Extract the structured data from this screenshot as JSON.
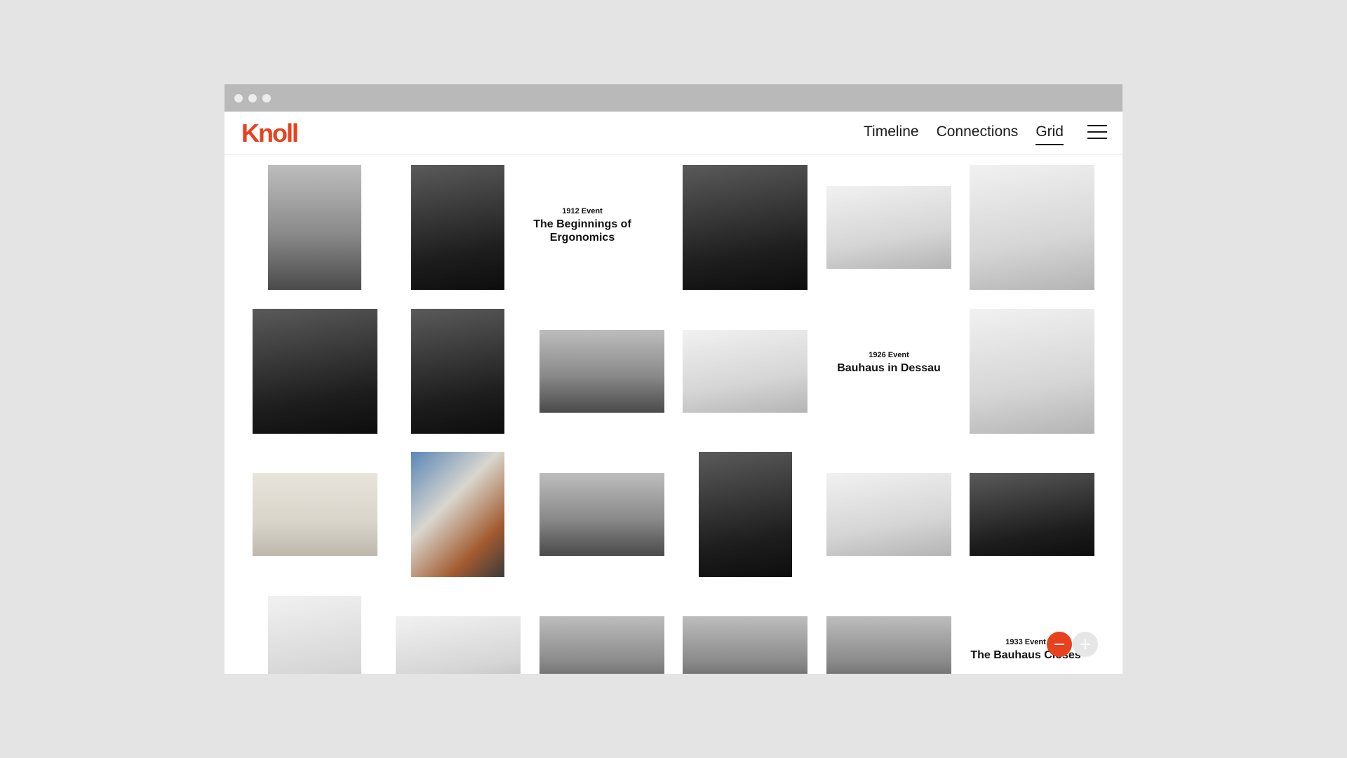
{
  "brand": {
    "logo_text": "Knoll",
    "accent_color": "#e8411d"
  },
  "nav": {
    "items": [
      "Timeline",
      "Connections",
      "Grid"
    ],
    "active": "Grid",
    "menu_icon": "hamburger-menu-icon"
  },
  "events": [
    {
      "year": "1912 Event",
      "title": "The Beginnings of Ergonomics"
    },
    {
      "year": "1926 Event",
      "title": "Bauhaus in Dessau"
    },
    {
      "year": "1933 Event",
      "title": "The Bauhaus Closes"
    }
  ],
  "zoom": {
    "out_icon": "minus-icon",
    "in_icon": "plus-icon"
  }
}
